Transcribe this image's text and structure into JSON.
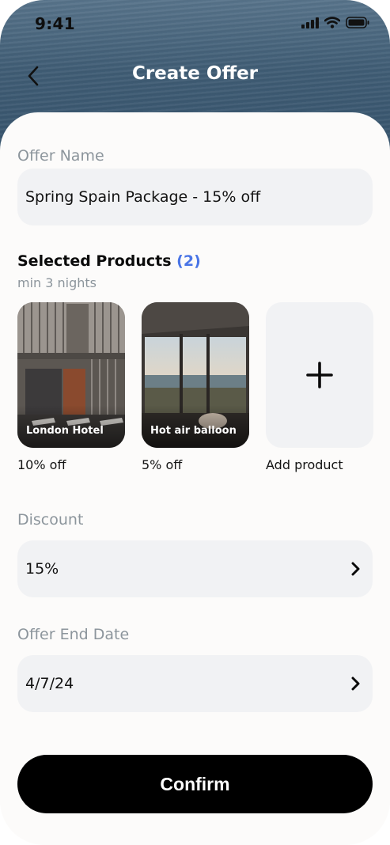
{
  "status_bar": {
    "time": "9:41",
    "icons": [
      "signal-icon",
      "wifi-icon",
      "battery-icon"
    ]
  },
  "header": {
    "title": "Create Offer",
    "back_icon": "chevron-left-icon"
  },
  "offer_name": {
    "label": "Offer Name",
    "value": "Spring Spain Package - 15% off"
  },
  "selected_products": {
    "title": "Selected Products",
    "count": "(2)",
    "subtitle": "min 3 nights",
    "items": [
      {
        "name": "London Hotel",
        "caption": "10% off"
      },
      {
        "name": "Hot air balloon",
        "caption": "5% off"
      }
    ],
    "add_label": "Add product"
  },
  "discount": {
    "label": "Discount",
    "value": "15%"
  },
  "end_date": {
    "label": "Offer End Date",
    "value": "4/7/24"
  },
  "confirm_label": "Confirm",
  "colors": {
    "accent": "#4a75e6",
    "button": "#000000",
    "field_bg": "#f1f2f4"
  }
}
